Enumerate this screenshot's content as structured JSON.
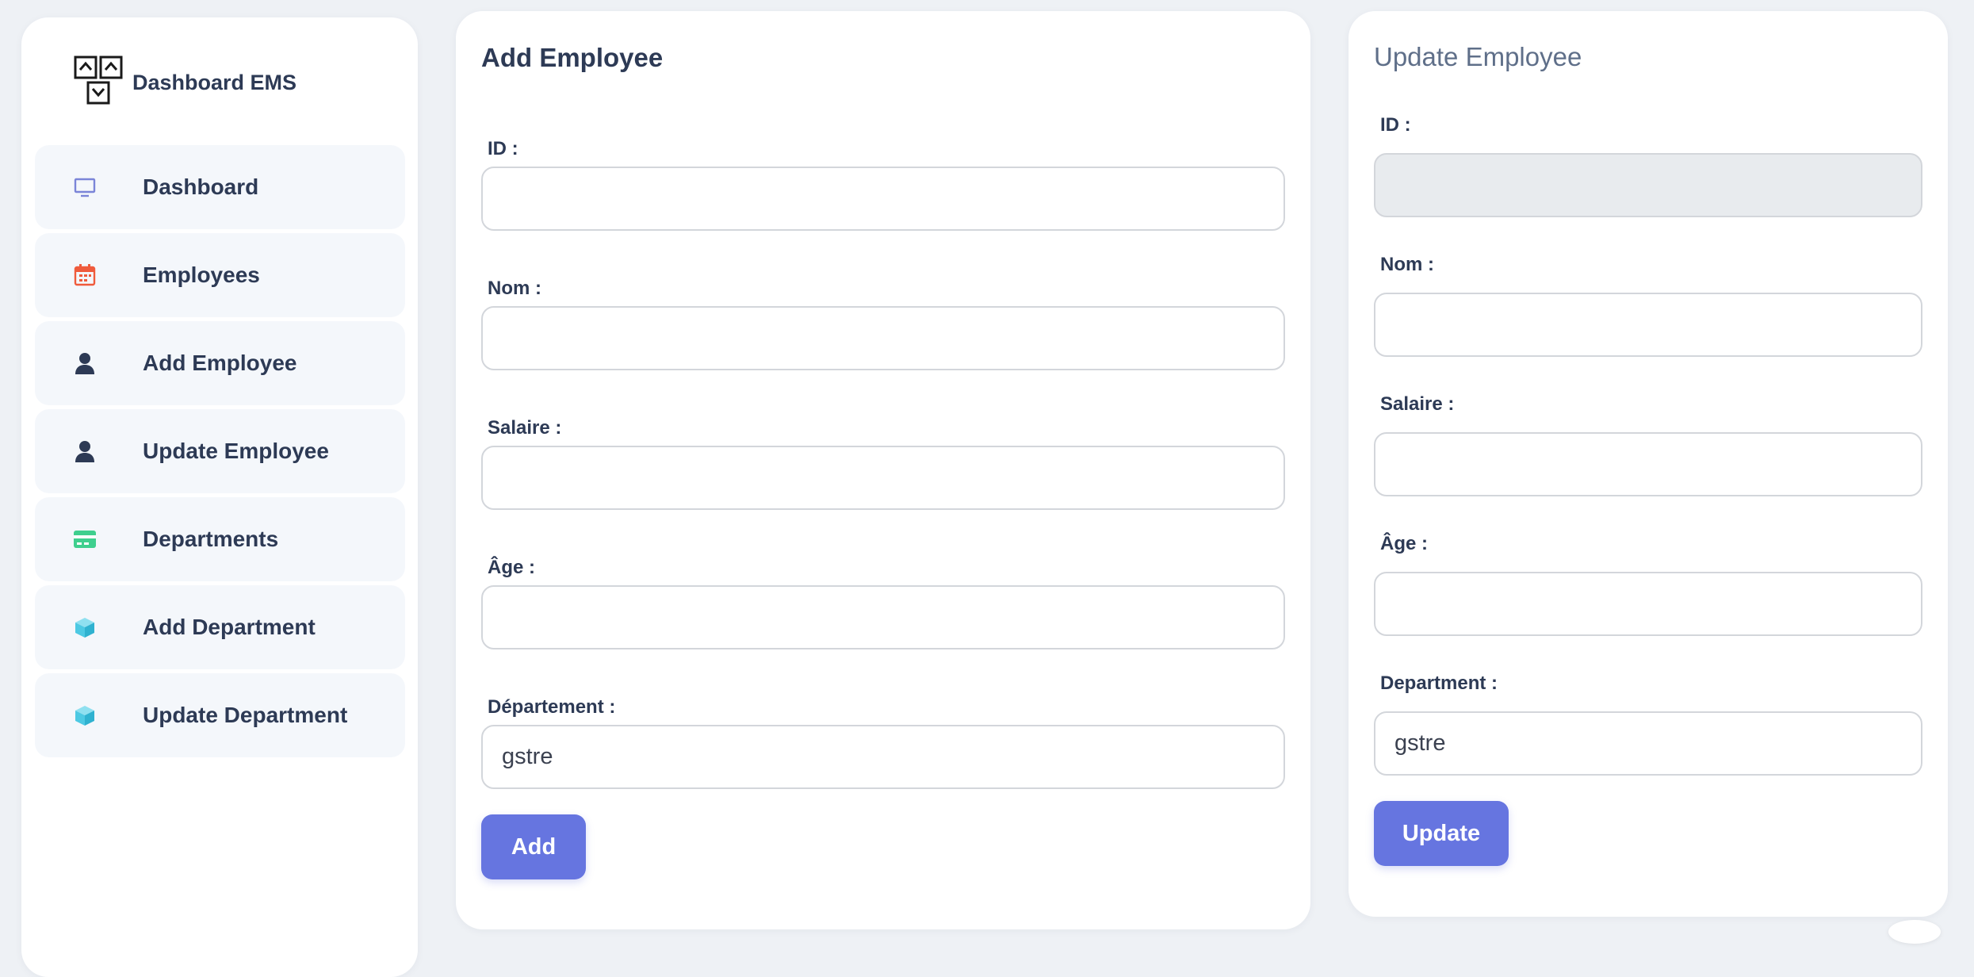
{
  "sidebar": {
    "brand": "Dashboard EMS",
    "items": [
      {
        "label": "Dashboard",
        "icon": "monitor-icon",
        "color": "#7b85d8"
      },
      {
        "label": "Employees",
        "icon": "calendar-icon",
        "color": "#ef5b3c"
      },
      {
        "label": "Add Employee",
        "icon": "user-icon",
        "color": "#2d3a55"
      },
      {
        "label": "Update Employee",
        "icon": "user-icon",
        "color": "#2d3a55"
      },
      {
        "label": "Departments",
        "icon": "card-icon",
        "color": "#3fcf8e"
      },
      {
        "label": "Add Department",
        "icon": "cube-icon",
        "color": "#4dc9e3"
      },
      {
        "label": "Update Department",
        "icon": "cube-icon",
        "color": "#4dc9e3"
      }
    ]
  },
  "add_form": {
    "title": "Add Employee",
    "fields": [
      {
        "label": "ID :",
        "value": ""
      },
      {
        "label": "Nom :",
        "value": ""
      },
      {
        "label": "Salaire :",
        "value": ""
      },
      {
        "label": "Âge :",
        "value": ""
      },
      {
        "label": "Département :",
        "value": "gstre"
      }
    ],
    "button": "Add"
  },
  "update_form": {
    "title": "Update Employee",
    "fields": [
      {
        "label": "ID :",
        "value": "",
        "disabled": true
      },
      {
        "label": "Nom :",
        "value": ""
      },
      {
        "label": "Salaire :",
        "value": ""
      },
      {
        "label": "Âge :",
        "value": ""
      },
      {
        "label": "Department :",
        "value": "gstre"
      }
    ],
    "button": "Update"
  },
  "colors": {
    "accent": "#6675e0",
    "background": "#eef1f5"
  }
}
